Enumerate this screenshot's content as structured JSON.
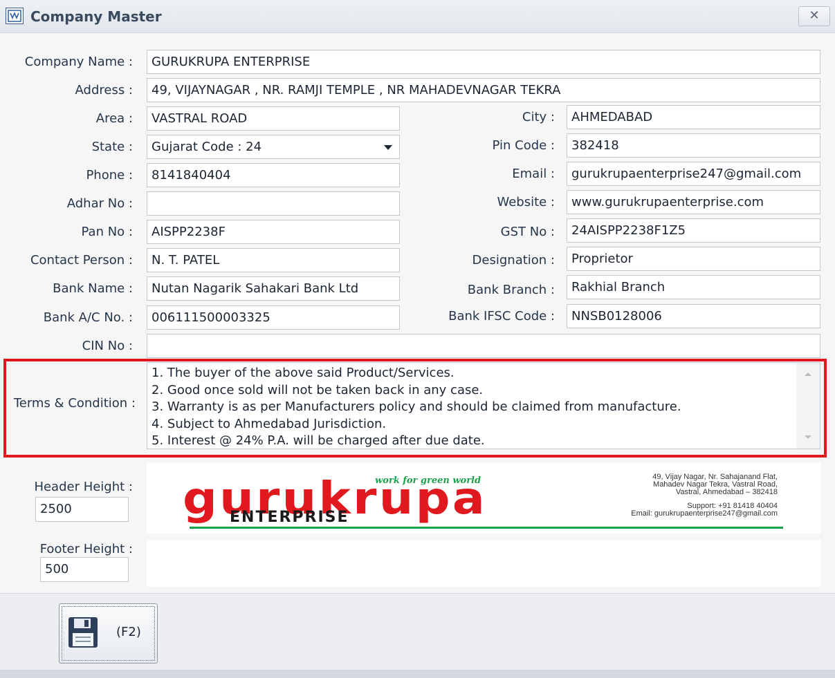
{
  "window": {
    "title": "Company Master",
    "close_label": "✕"
  },
  "fields": {
    "company_name": {
      "label": "Company Name :",
      "value": "GURUKRUPA ENTERPRISE"
    },
    "address": {
      "label": "Address :",
      "value": "49, VIJAYNAGAR , NR. RAMJI TEMPLE , NR MAHADEVNAGAR TEKRA"
    },
    "area": {
      "label": "Area :",
      "value": "VASTRAL ROAD"
    },
    "city": {
      "label": "City :",
      "value": "AHMEDABAD"
    },
    "state": {
      "label": "State :",
      "value": "Gujarat Code : 24"
    },
    "pin_code": {
      "label": "Pin Code :",
      "value": "382418"
    },
    "phone": {
      "label": "Phone :",
      "value": "8141840404"
    },
    "email": {
      "label": "Email :",
      "value": "gurukrupaenterprise247@gmail.com"
    },
    "adhar_no": {
      "label": "Adhar No :",
      "value": ""
    },
    "website": {
      "label": "Website :",
      "value": "www.gurukrupaenterprise.com"
    },
    "pan_no": {
      "label": "Pan No :",
      "value": "AISPP2238F"
    },
    "gst_no": {
      "label": "GST No :",
      "value": "24AISPP2238F1Z5"
    },
    "contact_person": {
      "label": "Contact Person :",
      "value": "N. T. PATEL"
    },
    "designation": {
      "label": "Designation :",
      "value": "Proprietor"
    },
    "bank_name": {
      "label": "Bank Name :",
      "value": "Nutan Nagarik Sahakari Bank Ltd"
    },
    "bank_branch": {
      "label": "Bank Branch :",
      "value": "Rakhial Branch"
    },
    "bank_ac_no": {
      "label": "Bank A/C No. :",
      "value": "006111500003325"
    },
    "bank_ifsc": {
      "label": "Bank IFSC Code :",
      "value": "NNSB0128006"
    },
    "cin_no": {
      "label": "CIN No :",
      "value": ""
    }
  },
  "terms": {
    "label": "Terms & Condition :",
    "lines": [
      "1. The buyer of the above said Product/Services.",
      "2. Good once sold will not be taken back in any case.",
      "3. Warranty is as per Manufacturers policy and should be claimed from manufacture.",
      "4. Subject to Ahmedabad Jurisdiction.",
      "5. Interest @ 24% P.A. will be charged after due date."
    ]
  },
  "header": {
    "label": "Header Height :",
    "value": "2500",
    "logo": {
      "tagline": "work for green world",
      "brand": "gurukrupa",
      "sub": "ENTERPRISE",
      "address_lines": [
        "49, Vijay Nagar, Nr. Sahajanand Flat,",
        "Mahadev Nagar Tekra, Vastral Road,",
        "Vastral, Ahmedabad – 382418"
      ],
      "support": "Support: +91 81418 40404",
      "email": "Email: gurukrupaenterprise247@gmail.com"
    }
  },
  "footer": {
    "label": "Footer Height :",
    "value": "500"
  },
  "toolbar": {
    "save_shortcut": "(F2)"
  },
  "colors": {
    "highlight": "#e0191f",
    "brand_red": "#e0191f",
    "brand_green": "#1aa24a"
  }
}
